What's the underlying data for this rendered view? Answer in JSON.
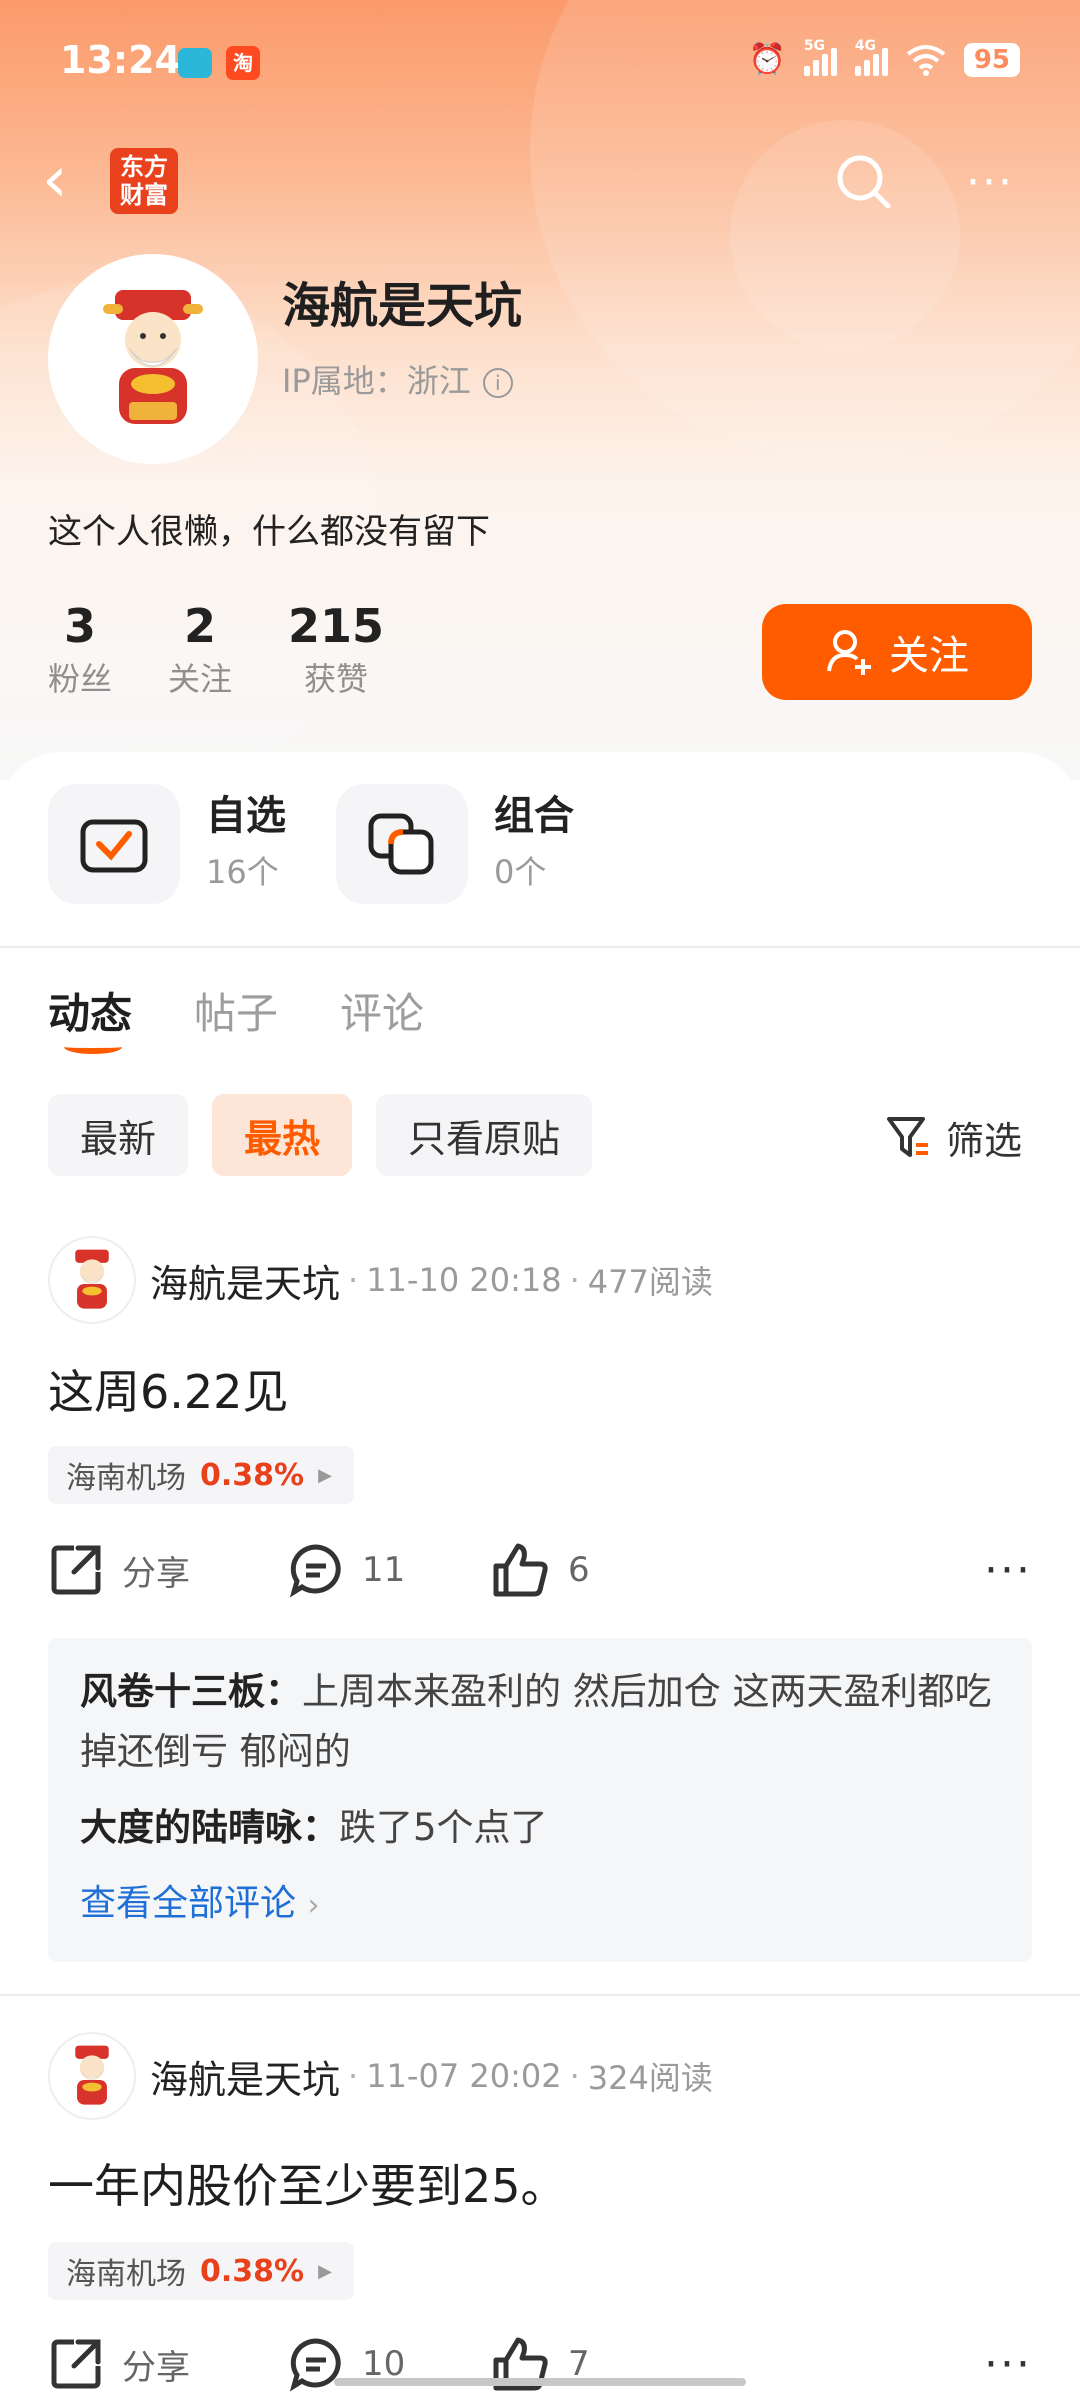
{
  "status_bar": {
    "time": "13:24",
    "app_badge": "淘",
    "battery": "95",
    "net1": "5G",
    "net2": "4G"
  },
  "nav": {
    "logo_line1": "东方",
    "logo_line2": "财富"
  },
  "profile": {
    "name": "海航是天坑",
    "ip_location": "IP属地：浙江",
    "bio": "这个人很懒，什么都没有留下",
    "stats": [
      {
        "value": "3",
        "label": "粉丝"
      },
      {
        "value": "2",
        "label": "关注"
      },
      {
        "value": "215",
        "label": "获赞"
      }
    ],
    "follow_label": "关注"
  },
  "quick_cards": [
    {
      "title": "自选",
      "count": "16个"
    },
    {
      "title": "组合",
      "count": "0个"
    }
  ],
  "tabs": [
    "动态",
    "帖子",
    "评论"
  ],
  "filters": [
    "最新",
    "最热",
    "只看原贴"
  ],
  "filter_button": "筛选",
  "posts": [
    {
      "author": "海航是天坑",
      "time": "11-10 20:18",
      "reads": "477阅读",
      "text": "这周6.22见",
      "stock": {
        "name": "海南机场",
        "change": "0.38%"
      },
      "share_label": "分享",
      "comments_count": "11",
      "likes_count": "6",
      "comments": [
        {
          "user": "风卷十三板：",
          "text": "上周本来盈利的 然后加仓 这两天盈利都吃掉还倒亏 郁闷的"
        },
        {
          "user": "大度的陆晴咏：",
          "text": "跌了5个点了"
        }
      ],
      "view_all": "查看全部评论"
    },
    {
      "author": "海航是天坑",
      "time": "11-07 20:02",
      "reads": "324阅读",
      "text": "一年内股价至少要到25。",
      "stock": {
        "name": "海南机场",
        "change": "0.38%"
      },
      "share_label": "分享",
      "comments_count": "10",
      "likes_count": "7"
    }
  ],
  "colors": {
    "accent": "#ff5c00",
    "stock_up": "#e8411c",
    "link": "#1f6fd6"
  }
}
